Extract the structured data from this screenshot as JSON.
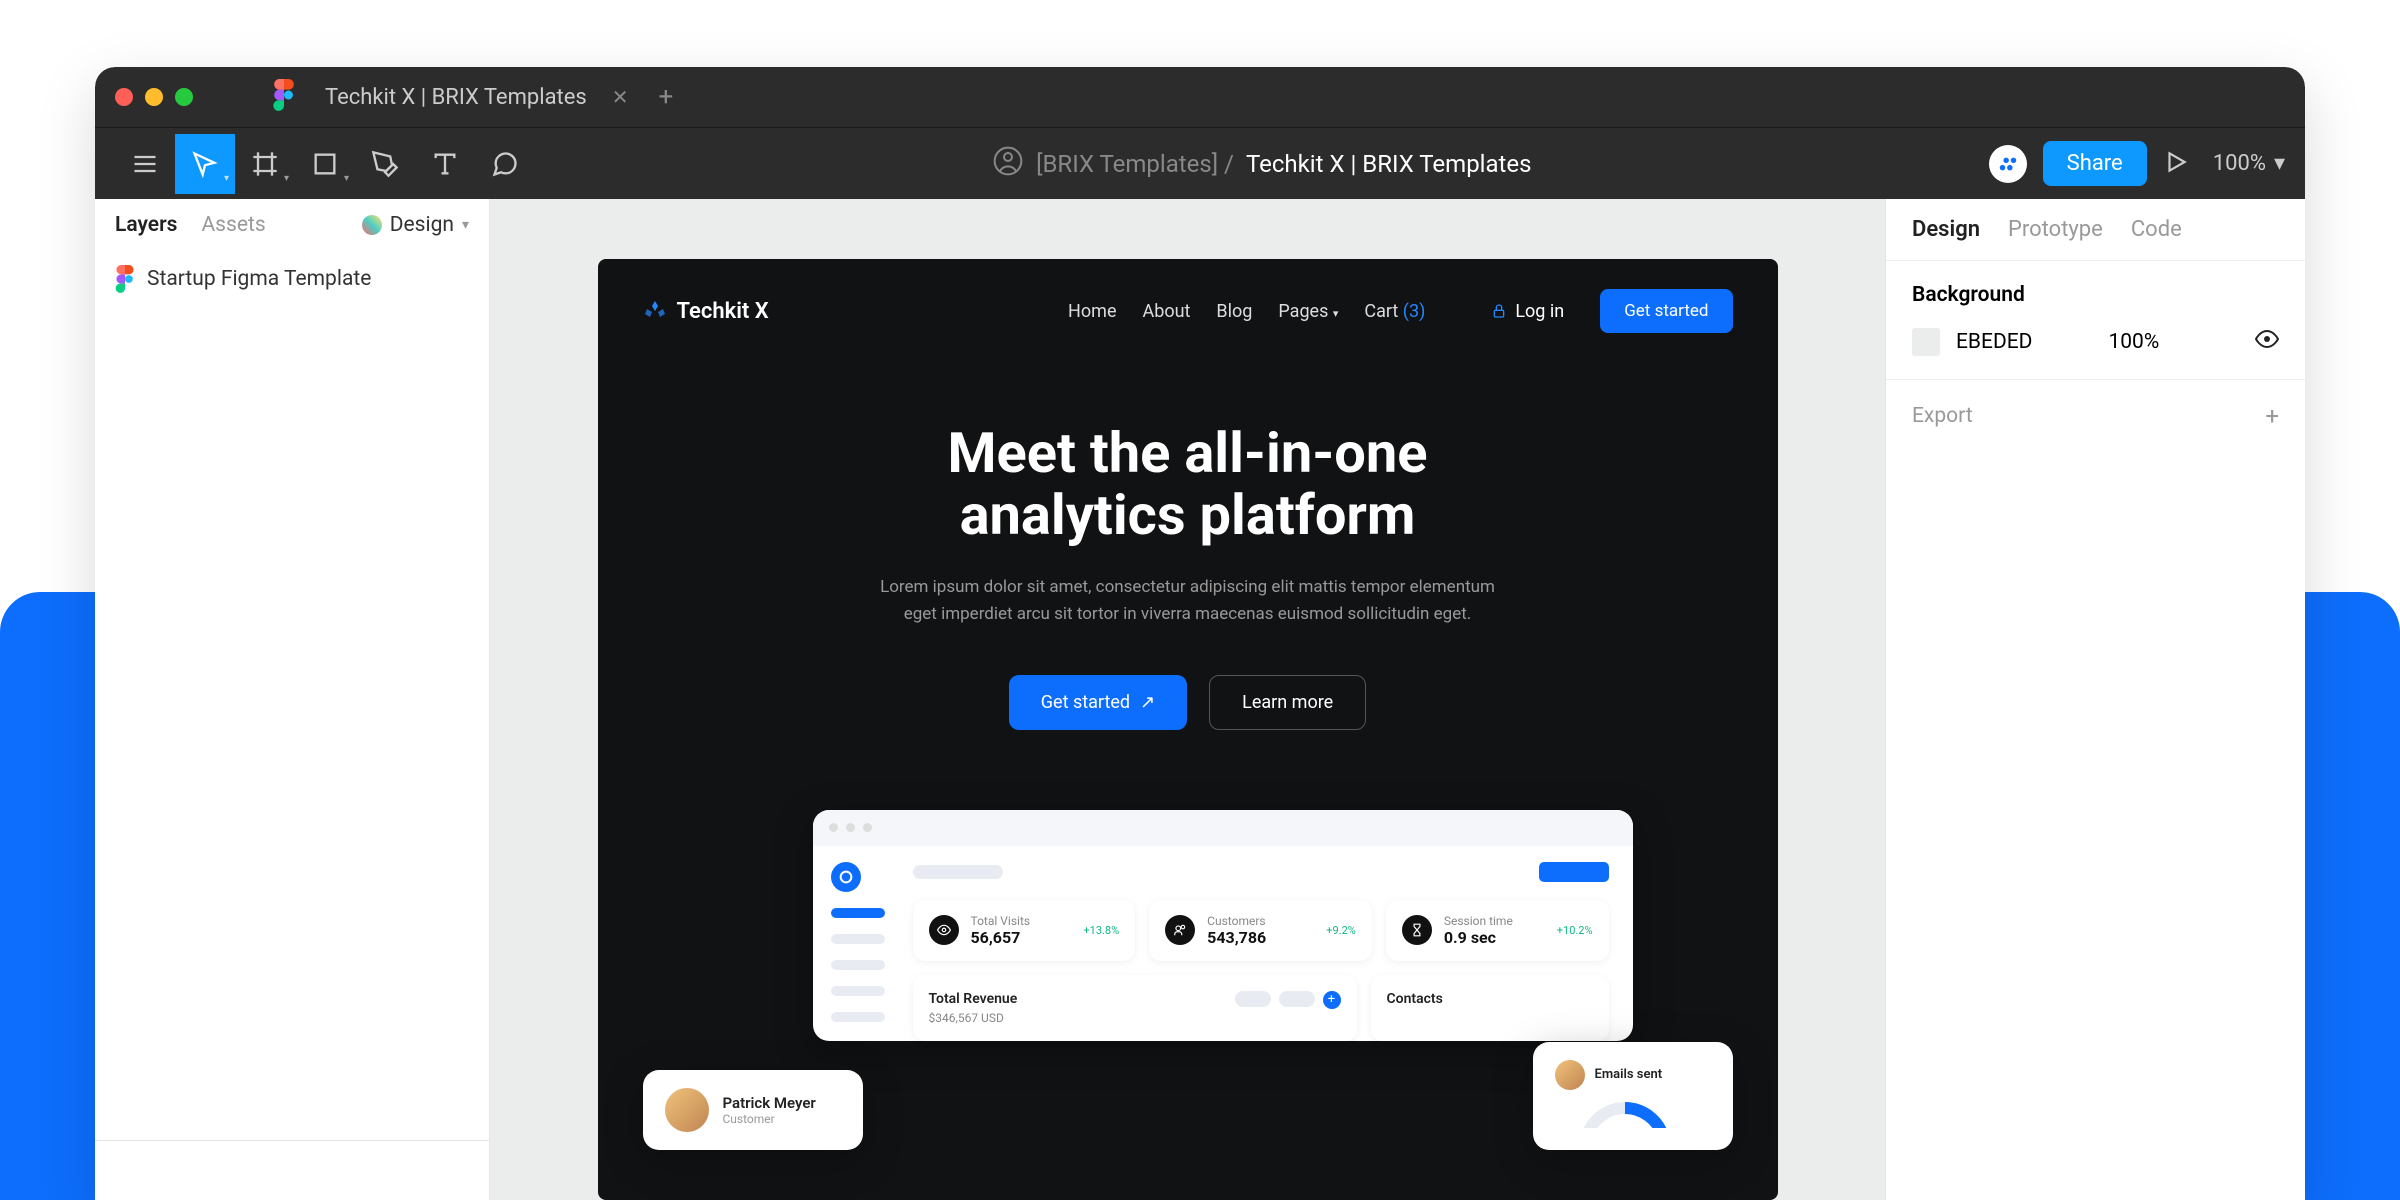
{
  "titlebar": {
    "tab_name": "Techkit X | BRIX Templates"
  },
  "toolbar": {
    "project_prefix": "[BRIX Templates] /",
    "project_name": "Techkit X | BRIX Templates",
    "share": "Share",
    "zoom": "100%"
  },
  "left_panel": {
    "tabs": {
      "layers": "Layers",
      "assets": "Assets",
      "design_dropdown": "Design"
    },
    "layers": [
      {
        "name": "Startup Figma Template"
      }
    ]
  },
  "right_panel": {
    "tabs": {
      "design": "Design",
      "prototype": "Prototype",
      "code": "Code"
    },
    "background": {
      "title": "Background",
      "hex": "EBEDED",
      "opacity": "100%"
    },
    "export": "Export"
  },
  "artboard": {
    "brand": "Techkit X",
    "nav": {
      "home": "Home",
      "about": "About",
      "blog": "Blog",
      "pages": "Pages",
      "cart": "Cart",
      "cart_count": "(3)",
      "login": "Log in",
      "get_started": "Get started"
    },
    "hero": {
      "title_l1": "Meet the all-in-one",
      "title_l2": "analytics platform",
      "subtitle": "Lorem ipsum dolor sit amet, consectetur adipiscing elit mattis tempor elementum eget imperdiet arcu sit tortor in viverra maecenas euismod sollicitudin eget.",
      "cta_primary": "Get started",
      "cta_secondary": "Learn more"
    },
    "dashboard": {
      "stats": [
        {
          "label": "Total Visits",
          "value": "56,657",
          "delta": "+13.8%"
        },
        {
          "label": "Customers",
          "value": "543,786",
          "delta": "+9.2%"
        },
        {
          "label": "Session time",
          "value": "0.9 sec",
          "delta": "+10.2%"
        }
      ],
      "revenue": {
        "label": "Total Revenue",
        "value": "$346,567 USD"
      },
      "contacts": {
        "label": "Contacts"
      },
      "float_left": {
        "name": "Patrick Meyer",
        "role": "Customer"
      },
      "float_right": {
        "label": "Emails sent"
      }
    }
  }
}
